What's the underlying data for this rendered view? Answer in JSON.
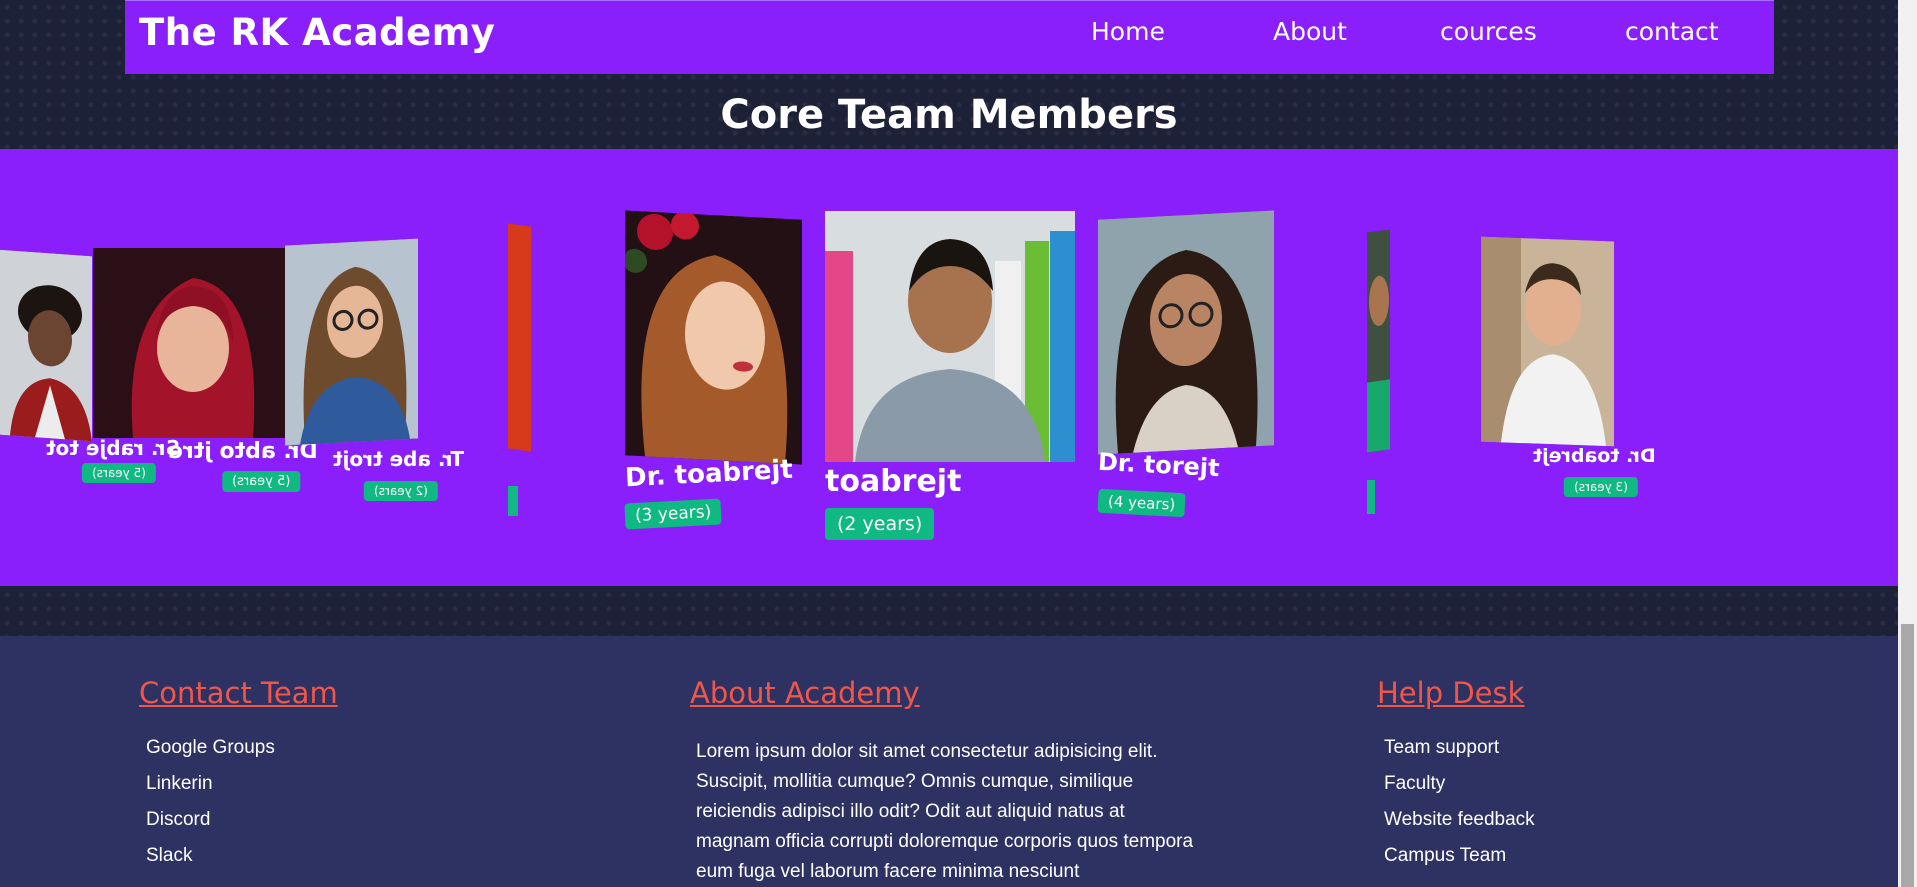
{
  "nav": {
    "brand": "The RK Academy",
    "links": [
      "Home",
      "About",
      "cources",
      "contact"
    ]
  },
  "team": {
    "title": "Core Team Members",
    "members": [
      {
        "name": "Sr. rabje tot",
        "years": "(5 years)",
        "mirrored": true
      },
      {
        "name": "Dr. abto jtre",
        "years": "(5 years)",
        "mirrored": true
      },
      {
        "name": "Tr. abe trojt",
        "years": "(2 years)",
        "mirrored": true
      },
      {
        "name": "Dr. toabrejt",
        "years": "(3 years)",
        "mirrored": false
      },
      {
        "name": "toabrejt",
        "years": "(2 years)",
        "mirrored": false
      },
      {
        "name": "Dr. torejt",
        "years": "(4 years)",
        "mirrored": false
      },
      {
        "name": "Dr. toabrejt",
        "years": "(3 years)",
        "mirrored": true
      }
    ],
    "slide_count": 11,
    "active_slide": 8
  },
  "footer": {
    "contact": {
      "title": "Contact Team",
      "items": [
        "Google Groups",
        "Linkerin",
        "Discord",
        "Slack"
      ]
    },
    "about": {
      "title": "About Academy",
      "text": "Lorem ipsum dolor sit amet consectetur adipisicing elit. Suscipit, mollitia cumque? Omnis cumque, similique reiciendis adipisci illo odit? Odit aut aliquid natus at magnam officia corrupti doloremque corporis quos tempora eum fuga vel laborum facere minima nesciunt"
    },
    "help": {
      "title": "Help Desk",
      "items": [
        "Team support",
        "Faculty",
        "Website feedback",
        "Campus Team"
      ]
    }
  },
  "colors": {
    "accent": "#8b1ffb",
    "badge": "#10b981",
    "footer_heading": "#f0564a",
    "footer_bg": "#2e3263"
  }
}
